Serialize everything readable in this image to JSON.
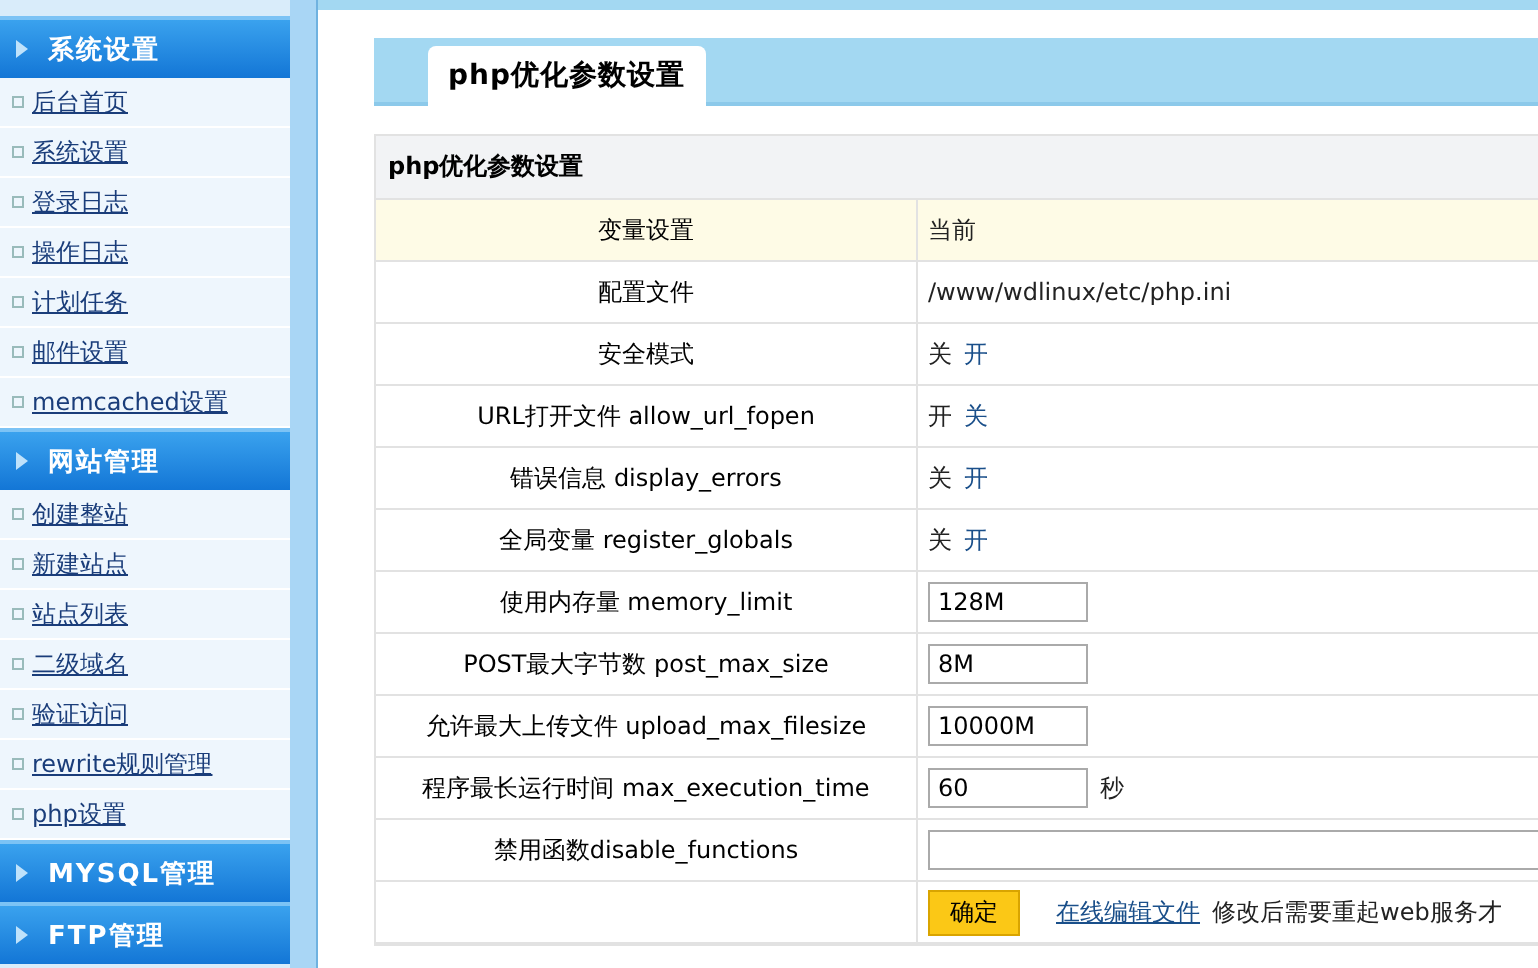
{
  "sidebar": {
    "groups": [
      {
        "title": "系统设置",
        "items": [
          "后台首页",
          "系统设置",
          "登录日志",
          "操作日志",
          "计划任务",
          "邮件设置",
          "memcached设置"
        ]
      },
      {
        "title": "网站管理",
        "items": [
          "创建整站",
          "新建站点",
          "站点列表",
          "二级域名",
          "验证访问",
          "rewrite规则管理",
          "php设置"
        ]
      },
      {
        "title": "MYSQL管理"
      },
      {
        "title": "FTP管理"
      }
    ]
  },
  "tab": {
    "label": "php优化参数设置"
  },
  "table": {
    "title": "php优化参数设置",
    "rows": [
      {
        "kind": "header",
        "label": "变量设置",
        "value": "当前"
      },
      {
        "kind": "text",
        "label": "配置文件",
        "value": "/www/wdlinux/etc/php.ini"
      },
      {
        "kind": "toggle",
        "label": "安全模式",
        "options": [
          {
            "label": "关",
            "selected": true
          },
          {
            "label": "开",
            "selected": false
          }
        ]
      },
      {
        "kind": "toggle",
        "label": "URL打开文件 allow_url_fopen",
        "options": [
          {
            "label": "开",
            "selected": true
          },
          {
            "label": "关",
            "selected": false
          }
        ]
      },
      {
        "kind": "toggle",
        "label": "错误信息 display_errors",
        "options": [
          {
            "label": "关",
            "selected": true
          },
          {
            "label": "开",
            "selected": false
          }
        ]
      },
      {
        "kind": "toggle",
        "label": "全局变量 register_globals",
        "options": [
          {
            "label": "关",
            "selected": true
          },
          {
            "label": "开",
            "selected": false
          }
        ]
      },
      {
        "kind": "input",
        "label": "使用内存量 memory_limit",
        "value": "128M"
      },
      {
        "kind": "input",
        "label": "POST最大字节数 post_max_size",
        "value": "8M"
      },
      {
        "kind": "input",
        "label": "允许最大上传文件 upload_max_filesize",
        "value": "10000M"
      },
      {
        "kind": "input",
        "label": "程序最长运行时间 max_execution_time",
        "value": "60",
        "unit": "秒"
      },
      {
        "kind": "wide",
        "label": "禁用函数disable_functions",
        "value": ""
      },
      {
        "kind": "actions",
        "button": "确定",
        "link": "在线编辑文件",
        "note": "修改后需要重起web服务才"
      }
    ]
  }
}
